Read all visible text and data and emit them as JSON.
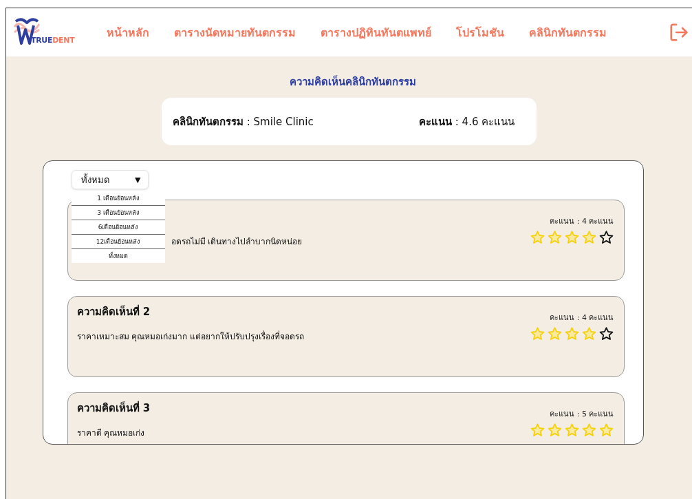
{
  "nav": {
    "logo": {
      "part_1": "TRUE",
      "part_2": "DENT"
    },
    "items": [
      "หน้าหลัก",
      "ตารางนัดหมายทันตกรรม",
      "ตารางปฏิทินทันตแพทย์",
      "โปรโมชัน",
      "คลินิกทันตกรรม"
    ]
  },
  "page_title": "ความคิดเห็นคลินิกทันตกรรม",
  "clinic_info": {
    "clinic": "**คลินิกทันตกรรม** : Smile Clinic",
    "score": "**คะแนน** : 4.6 คะแนน"
  },
  "filter": {
    "value": "ทั้งหมด",
    "caret": "▼",
    "expanded": true,
    "options": [
      "1 เดือนย้อนหลัง",
      "3 เดือนย้อนหลัง",
      "6เดือนย้อนหลัง",
      "12เดือนย้อนหลัง",
      "ทั้งหมด"
    ]
  },
  "reviews": [
    {
      "text": "อดรถไม่มี เดินทางไปลำบากนิดหน่อย",
      "score": "คะแนน : 4 คะแนน",
      "stars": 4
    },
    {
      "title": "ความคิดเห็นที่ 2",
      "text": "ราคาเหมาะสม คุณหมอเก่งมาก แต่อยากให้ปรับปรุงเรื่องที่จอดรถ",
      "score": "คะแนน : 4 คะแนน",
      "stars": 4
    },
    {
      "title": "ความคิดเห็นที่ 3",
      "text": "ราคาดี คุณหมอเก่ง",
      "score": "คะแนน : 5 คะแนน",
      "stars": 5
    }
  ]
}
